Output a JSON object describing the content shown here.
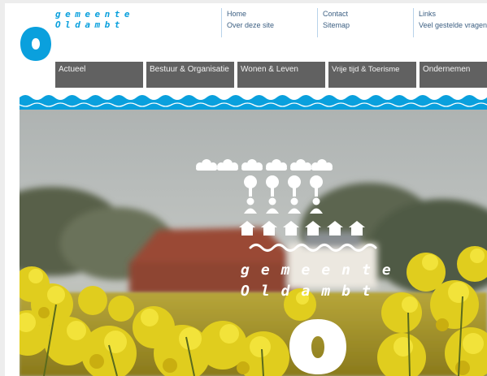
{
  "brand": {
    "line1": "gemeente",
    "line2": "Oldambt"
  },
  "toplinks": {
    "col1": [
      "Home",
      "Over deze site"
    ],
    "col2": [
      "Contact",
      "Sitemap"
    ],
    "col3": [
      "Links",
      "Veel gestelde vragen"
    ]
  },
  "nav": {
    "items": [
      "Actueel",
      "Bestuur & Organisatie",
      "Wonen & Leven",
      "Vrije tijd & Toerisme",
      "Ondernemen"
    ]
  },
  "hero": {
    "line1": "gemeente",
    "line2": "Oldambt"
  },
  "colors": {
    "brand_blue": "#0aa0dd",
    "nav_gray": "#616161",
    "link_text": "#3c5f82"
  }
}
